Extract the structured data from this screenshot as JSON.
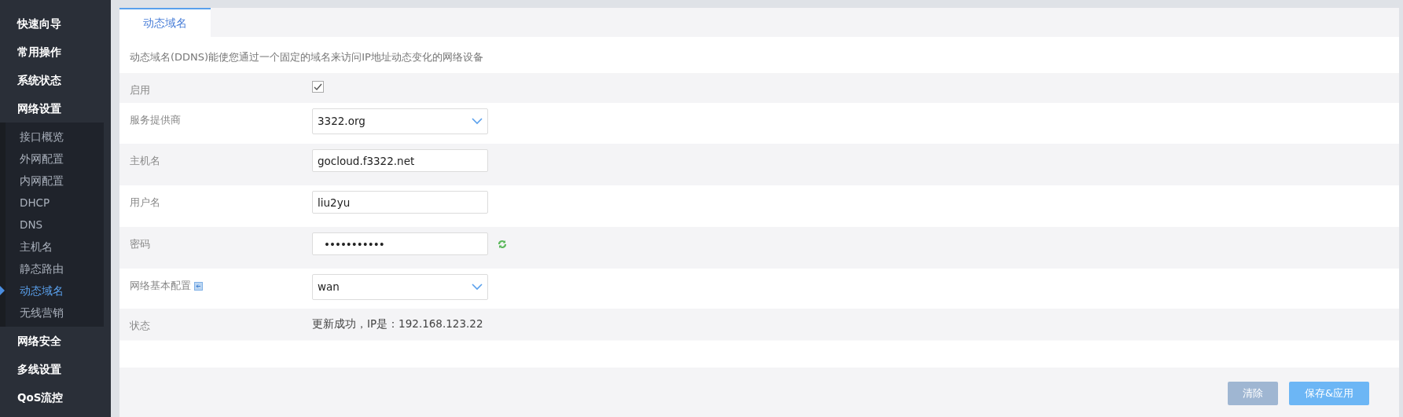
{
  "sidebar": {
    "items": [
      {
        "label": "快速向导"
      },
      {
        "label": "常用操作"
      },
      {
        "label": "系统状态"
      },
      {
        "label": "网络设置",
        "expanded": true,
        "children": [
          {
            "label": "接口概览",
            "selected": false
          },
          {
            "label": "外网配置",
            "selected": false
          },
          {
            "label": "内网配置",
            "selected": false
          },
          {
            "label": "DHCP",
            "selected": false
          },
          {
            "label": "DNS",
            "selected": false
          },
          {
            "label": "主机名",
            "selected": false
          },
          {
            "label": "静态路由",
            "selected": false
          },
          {
            "label": "动态域名",
            "selected": true
          },
          {
            "label": "无线营销",
            "selected": false
          }
        ]
      },
      {
        "label": "网络安全"
      },
      {
        "label": "多线设置"
      },
      {
        "label": "QoS流控"
      }
    ]
  },
  "tabs": [
    {
      "label": "动态域名",
      "selected": true
    }
  ],
  "description": "动态域名(DDNS)能使您通过一个固定的域名来访问IP地址动态变化的网络设备",
  "form": {
    "rows": [
      {
        "kind": "checkbox",
        "label": "启用",
        "checked": true
      },
      {
        "kind": "select",
        "label": "服务提供商",
        "value": "3322.org"
      },
      {
        "kind": "text",
        "label": "主机名",
        "value": "gocloud.f3322.net"
      },
      {
        "kind": "text",
        "label": "用户名",
        "value": "liu2yu"
      },
      {
        "kind": "password",
        "label": "密码",
        "value": "•••••••••••"
      },
      {
        "kind": "select",
        "label": "网络基本配置",
        "value": "wan",
        "help": true
      },
      {
        "kind": "status",
        "label": "状态",
        "value": "更新成功，IP是：192.168.123.22"
      }
    ]
  },
  "buttons": [
    {
      "label": "清除",
      "disabled": true
    },
    {
      "label": "保存&应用",
      "disabled": false
    }
  ]
}
